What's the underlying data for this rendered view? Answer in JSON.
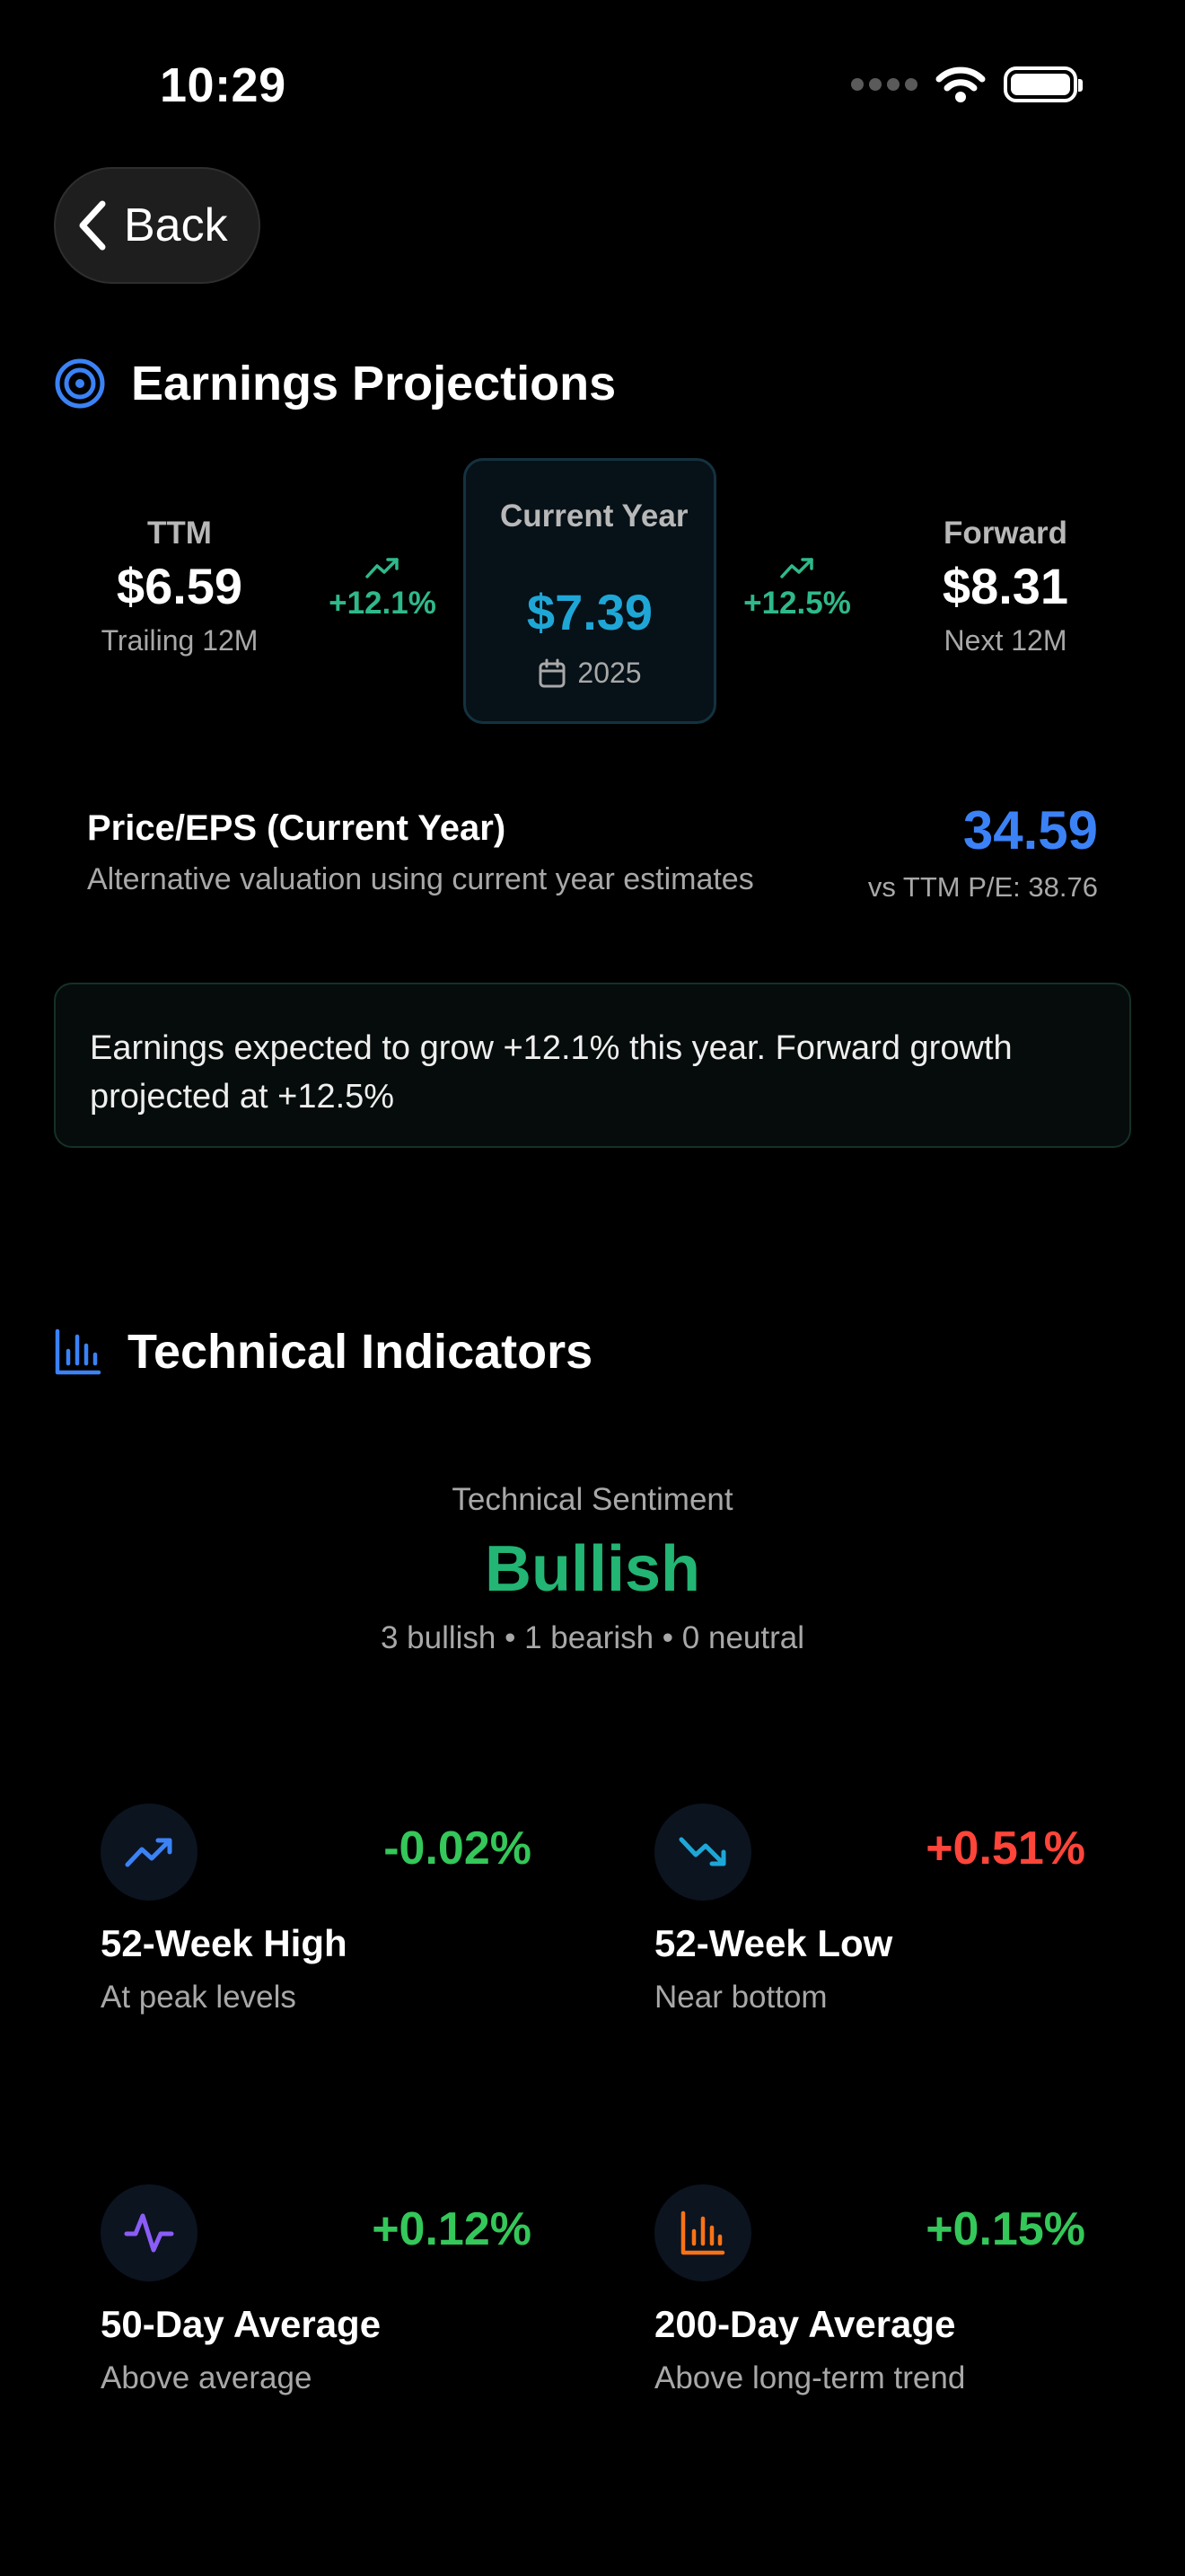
{
  "status_bar": {
    "time": "10:29"
  },
  "nav": {
    "back_label": "Back"
  },
  "earnings": {
    "title": "Earnings Projections",
    "ttm": {
      "label": "TTM",
      "value": "$6.59",
      "sub": "Trailing 12M"
    },
    "growth_current": "+12.1%",
    "current_year": {
      "label": "Current Year",
      "value": "$7.39",
      "year": "2025"
    },
    "growth_forward": "+12.5%",
    "forward": {
      "label": "Forward",
      "value": "$8.31",
      "sub": "Next 12M"
    },
    "pe": {
      "title": "Price/EPS (Current Year)",
      "subtitle": "Alternative valuation using current year estimates",
      "value": "34.59",
      "vs": "vs TTM P/E: 38.76"
    },
    "note": "Earnings expected to grow +12.1% this year. Forward growth projected at +12.5%"
  },
  "technical": {
    "title": "Technical Indicators",
    "sentiment_label": "Technical Sentiment",
    "sentiment_value": "Bullish",
    "counts": "3 bullish • 1 bearish • 0 neutral",
    "indicators": [
      {
        "icon": "trending-up-icon",
        "title": "52-Week High",
        "desc": "At peak levels",
        "change": "-0.02%",
        "change_color": "#34c759",
        "icon_color": "#3b82f6"
      },
      {
        "icon": "trending-down-icon",
        "title": "52-Week Low",
        "desc": "Near bottom",
        "change": "+0.51%",
        "change_color": "#ff453a",
        "icon_color": "#1ea7d6"
      },
      {
        "icon": "activity-icon",
        "title": "50-Day Average",
        "desc": "Above average",
        "change": "+0.12%",
        "change_color": "#34c759",
        "icon_color": "#8b5cf6"
      },
      {
        "icon": "bar-chart-icon",
        "title": "200-Day Average",
        "desc": "Above long-term trend",
        "change": "+0.15%",
        "change_color": "#34c759",
        "icon_color": "#f97316"
      }
    ]
  },
  "colors": {
    "accent_blue": "#3b82f6",
    "accent_cyan": "#1ea7d6",
    "positive": "#2fb98a",
    "bullish": "#22b573"
  }
}
